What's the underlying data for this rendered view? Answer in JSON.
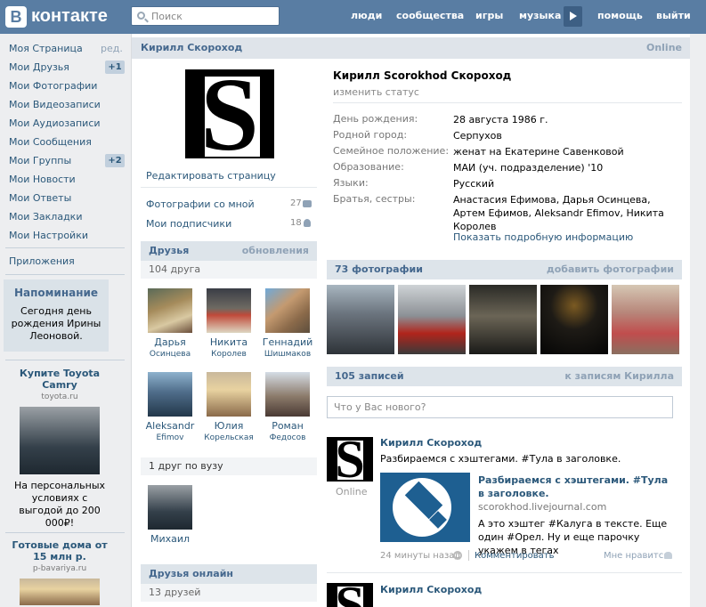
{
  "header": {
    "logo_letter": "В",
    "logo_text": "контакте",
    "search_placeholder": "Поиск",
    "nav": [
      "люди",
      "сообщества",
      "игры",
      "музыка",
      "помощь",
      "выйти"
    ]
  },
  "sidebar": {
    "items": [
      {
        "label": "Моя Страница",
        "extra": "ред."
      },
      {
        "label": "Мои Друзья",
        "badge": "+1"
      },
      {
        "label": "Мои Фотографии"
      },
      {
        "label": "Мои Видеозаписи"
      },
      {
        "label": "Мои Аудиозаписи"
      },
      {
        "label": "Мои Сообщения"
      },
      {
        "label": "Мои Группы",
        "badge": "+2"
      },
      {
        "label": "Мои Новости"
      },
      {
        "label": "Мои Ответы"
      },
      {
        "label": "Мои Закладки"
      },
      {
        "label": "Мои Настройки"
      }
    ],
    "apps": "Приложения",
    "reminder": {
      "title": "Напоминание",
      "text": "Сегодня день рождения Ирины Леоновой."
    },
    "ads": [
      {
        "title": "Купите Toyota Camry",
        "domain": "toyota.ru",
        "text": "На персональных условиях с выгодой до 200 000₽!"
      },
      {
        "title": "Готовые дома от 15 млн р.",
        "domain": "p-bavariya.ru"
      }
    ]
  },
  "profile": {
    "header_name": "Кирилл Скороход",
    "online": "Online",
    "edit": "Редактировать страницу",
    "photos_with_me": "Фотографии со мной",
    "photos_with_me_count": "27",
    "subscribers": "Мои подписчики",
    "subscribers_count": "18",
    "full_name": "Кирилл Scorokhod Скороход",
    "change_status": "изменить статус",
    "info": [
      {
        "k": "День рождения:",
        "v": "28 августа 1986 г."
      },
      {
        "k": "Родной город:",
        "v": "Серпухов"
      },
      {
        "k": "Семейное положение:",
        "v": "женат на Екатерине Савенковой"
      },
      {
        "k": "Образование:",
        "v": "МАИ (уч. подразделение) '10"
      },
      {
        "k": "Языки:",
        "v": "Русский"
      },
      {
        "k": "Братья, сестры:",
        "v": "Анастасия Ефимова, Дарья Осинцева, Артем Ефимов, Aleksandr Efimov, Никита Королев"
      }
    ],
    "more_info": "Показать подробную информацию"
  },
  "friends": {
    "title": "Друзья",
    "updates": "обновления",
    "count": "104 друга",
    "list": [
      {
        "n1": "Дарья",
        "n2": "Осинцева"
      },
      {
        "n1": "Никита",
        "n2": "Королев"
      },
      {
        "n1": "Геннадий",
        "n2": "Шишмаков"
      },
      {
        "n1": "Aleksandr",
        "n2": "Efimov"
      },
      {
        "n1": "Юлия",
        "n2": "Корельская"
      },
      {
        "n1": "Роман",
        "n2": "Федосов"
      }
    ],
    "uni": "1 друг по вузу",
    "uni_name": "Михаил",
    "online_title": "Друзья онлайн",
    "online_count": "13 друзей"
  },
  "photos": {
    "title": "73 фотографии",
    "add": "добавить фотографии"
  },
  "wall": {
    "title": "105 записей",
    "to_wall": "к записям Кирилла",
    "input_placeholder": "Что у Вас нового?",
    "post": {
      "author": "Кирилл Скороход",
      "online": "Online",
      "text": "Разбираемся с хэштегами. #Тула в заголовке.",
      "link_title": "Разбираемся с хэштегами. #Тула в заголовке.",
      "link_domain": "scorokhod.livejournal.com",
      "link_text": "А это хэштег #Калуга в тексте. Еще один #Орел. Ну и еще парочку укажем в тегах",
      "time": "24 минуты назад",
      "comment": "Комментировать",
      "like": "Мне нравится"
    },
    "post2": {
      "author": "Кирилл Скороход"
    }
  }
}
